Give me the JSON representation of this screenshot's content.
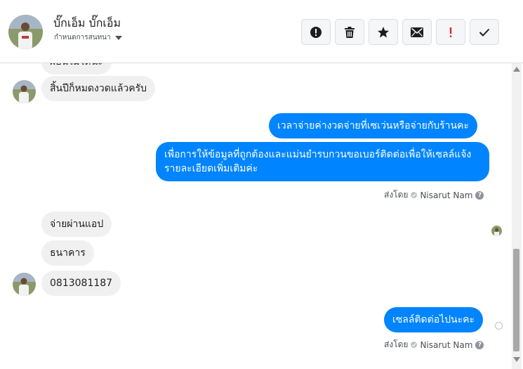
{
  "header": {
    "contact_name": "บั๊กเอ็ม บั๊กเอ็ม",
    "contact_sub": "กำหนดการสนทนา",
    "actions": [
      {
        "name": "report-spam-button",
        "icon": "alert-icon"
      },
      {
        "name": "delete-button",
        "icon": "trash-icon"
      },
      {
        "name": "star-button",
        "icon": "star-icon"
      },
      {
        "name": "mark-unread-button",
        "icon": "envelope-icon"
      },
      {
        "name": "mark-important-button",
        "icon": "exclamation-icon"
      },
      {
        "name": "mark-done-button",
        "icon": "check-icon"
      }
    ]
  },
  "messages": {
    "in_top_partial": "ผ่อนไม่ได้นะ",
    "in_1": "สิ้นปีก็หมดงวดแล้วครับ",
    "out_1": "เวลาจ่ายค่างวดจ่ายที่เซเว่นหรือจ่ายกับร้านคะ",
    "out_2": "เพื่อการให้ข้อมูลที่ถูกต้องและแม่นยำรบกวนขอเบอร์ติดต่อเพื่อให้เซลล์แจ้งรายละเอียดเพิ่มเติมค่ะ",
    "in_2": "จ่ายผ่านแอป",
    "in_3": "ธนาคาร",
    "in_4": "0813081187",
    "out_3": "เซลล์ติดต่อไปนะคะ"
  },
  "sent_by": {
    "label": "ส่งโดย",
    "name": "Nisarut Nam"
  },
  "colors": {
    "outgoing": "#0084ff",
    "incoming": "#f1f0f0"
  }
}
